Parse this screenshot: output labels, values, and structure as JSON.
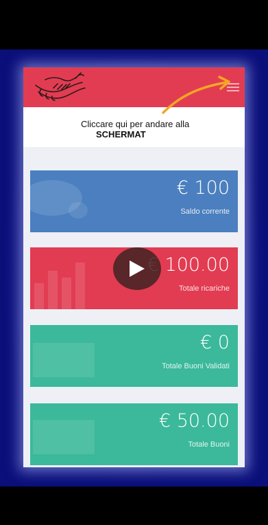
{
  "tip": {
    "line1": "Cliccare qui per andare alla",
    "line2": "SCHERMAT"
  },
  "cards": [
    {
      "amount": "€ 100",
      "label": "Saldo corrente",
      "color": "#4b7fbf"
    },
    {
      "amount": "€ 100.00",
      "label": "Totale ricariche",
      "color": "#e23c52"
    },
    {
      "amount": "€ 0",
      "label": "Totale Buoni Validati",
      "color": "#3bb99a"
    },
    {
      "amount": "€ 50.00",
      "label": "Totale Buoni",
      "color": "#3bb99a"
    }
  ],
  "colors": {
    "header": "#e23c52",
    "arrow": "#f5a623",
    "frame": "#0a0f7a"
  },
  "icons": {
    "logo": "handshake-icon",
    "menu": "hamburger-menu-icon",
    "play": "play-icon"
  }
}
